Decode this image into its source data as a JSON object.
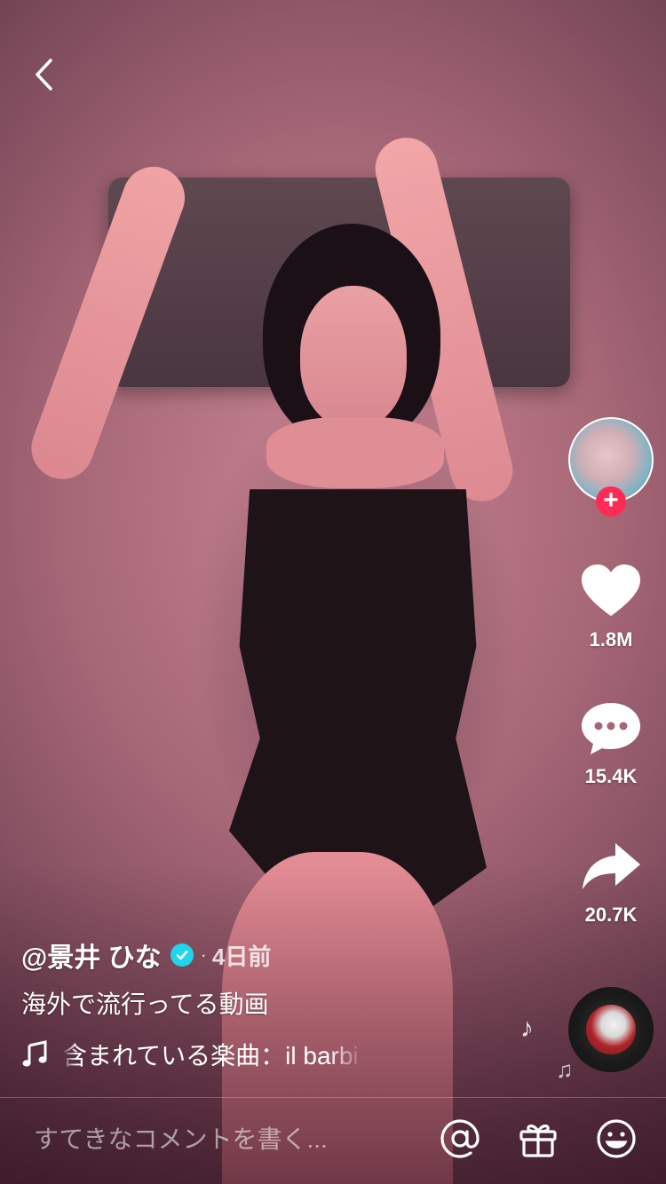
{
  "header": {
    "back_icon": "chevron-left-icon"
  },
  "creator": {
    "avatar_icon": "avatar",
    "follow_icon": "plus-icon",
    "follow_color": "#fe2c55"
  },
  "actions": {
    "like": {
      "icon": "heart-icon",
      "count": "1.8M"
    },
    "comment": {
      "icon": "comment-bubble-icon",
      "count": "15.4K"
    },
    "share": {
      "icon": "share-arrow-icon",
      "count": "20.7K"
    }
  },
  "post": {
    "username": "@景井 ひな",
    "verified_icon": "verified-badge-icon",
    "verified_color": "#20d5ec",
    "separator": "·",
    "time": "4日前",
    "caption": "海外で流行ってる動画",
    "music_icon": "music-note-icon",
    "music_text": "含まれている楽曲：il barbi"
  },
  "comment_bar": {
    "placeholder": "すてきなコメントを書く...",
    "icons": [
      "at-sign-icon",
      "gift-icon",
      "emoji-icon"
    ]
  }
}
